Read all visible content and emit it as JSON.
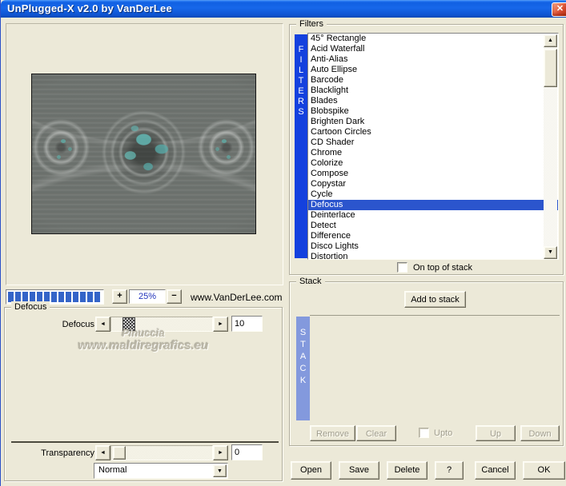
{
  "window": {
    "title": "UnPlugged-X v2.0 by VanDerLee",
    "close_glyph": "✕"
  },
  "preview": {
    "progress_segments": 13,
    "zoom_in_label": "+",
    "zoom_level": "25%",
    "zoom_out_label": "−",
    "website": "www.VanDerLee.com"
  },
  "filters": {
    "group_label": "Filters",
    "vertical_label": [
      "F",
      "I",
      "L",
      "T",
      "E",
      "R",
      "S"
    ],
    "items": [
      "45° Rectangle",
      "Acid Waterfall",
      "Anti-Alias",
      "Auto Ellipse",
      "Barcode",
      "Blacklight",
      "Blades",
      "Blobspike",
      "Brighten Dark",
      "Cartoon Circles",
      "CD Shader",
      "Chrome",
      "Colorize",
      "Compose",
      "Copystar",
      "Cycle",
      "Defocus",
      "Deinterlace",
      "Detect",
      "Difference",
      "Disco Lights",
      "Distortion"
    ],
    "selected_item": "Defocus",
    "scrollbar": {
      "up_glyph": "▲",
      "down_glyph": "▼"
    },
    "on_top_label": "On top of stack",
    "on_top_checked": false
  },
  "controls": {
    "group_label": "Defocus",
    "left_arrow_glyph": "◄",
    "right_arrow_glyph": "►",
    "sliders": [
      {
        "label": "Defocus",
        "value": "10"
      },
      {
        "label": "Transparency",
        "value": "0"
      }
    ],
    "blend_mode": {
      "selected": "Normal",
      "dropdown_glyph": "▼"
    },
    "watermark": {
      "line1": "Pinuccia",
      "line2": "www.maldiregrafics.eu"
    }
  },
  "stack": {
    "group_label": "Stack",
    "vertical_label": [
      "S",
      "T",
      "A",
      "C",
      "K"
    ],
    "add_button": "Add to stack",
    "items": [],
    "remove_button": "Remove",
    "clear_button": "Clear",
    "upto_label": "Upto",
    "upto_checked": false,
    "up_button": "Up",
    "down_button": "Down"
  },
  "footer": {
    "buttons": [
      {
        "label": "Open"
      },
      {
        "label": "Save"
      },
      {
        "label": "Delete"
      },
      {
        "label": "?"
      },
      {
        "label": "Cancel"
      },
      {
        "label": "OK"
      }
    ]
  },
  "colors": {
    "dialog_bg": "#ece9d8",
    "titlebar_blue": "#1160e2",
    "close_red": "#d6492f",
    "filters_bar_blue": "#1441de",
    "selection_blue": "#2b55cd",
    "stack_bar_blue": "#8399dd",
    "progress_blue": "#3464c8",
    "zoom_text_blue": "#2233bb"
  }
}
